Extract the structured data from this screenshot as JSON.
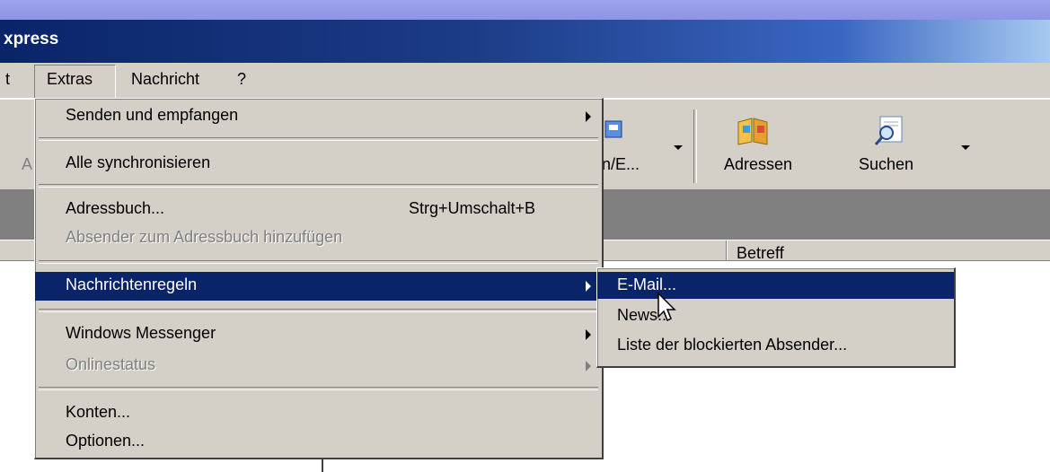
{
  "window": {
    "title": "xpress"
  },
  "menubar": {
    "partial_left": "t",
    "extras": "Extras",
    "nachricht": "Nachricht",
    "help": "?"
  },
  "toolbar": {
    "partial_left": "A",
    "send_receive": "n/E...",
    "addresses": "Adressen",
    "search": "Suchen"
  },
  "columns": {
    "subject": "Betreff"
  },
  "extras_menu": {
    "items": [
      {
        "label": "Senden und empfangen",
        "submenu": true
      },
      {
        "label": "Alle synchronisieren"
      },
      {
        "label": "Adressbuch...",
        "shortcut": "Strg+Umschalt+B"
      },
      {
        "label": "Absender zum Adressbuch hinzufügen",
        "disabled": true
      },
      {
        "label": "Nachrichtenregeln",
        "submenu": true,
        "highlighted": true
      },
      {
        "label": "Windows Messenger",
        "submenu": true
      },
      {
        "label": "Onlinestatus",
        "submenu": true,
        "disabled": true
      },
      {
        "label": "Konten..."
      },
      {
        "label": "Optionen..."
      }
    ]
  },
  "rules_submenu": {
    "items": [
      {
        "label": "E-Mail...",
        "highlighted": true
      },
      {
        "label": "News..."
      },
      {
        "label": "Liste der blockierten Absender..."
      }
    ]
  },
  "colors": {
    "highlight": "#0a246a",
    "menu_bg": "#d4d0c8",
    "title_start": "#0a246a",
    "title_end": "#a6caf0"
  },
  "icons": [
    "address-book-icon",
    "search-icon",
    "send-receive-icon",
    "mouse-cursor-icon"
  ]
}
